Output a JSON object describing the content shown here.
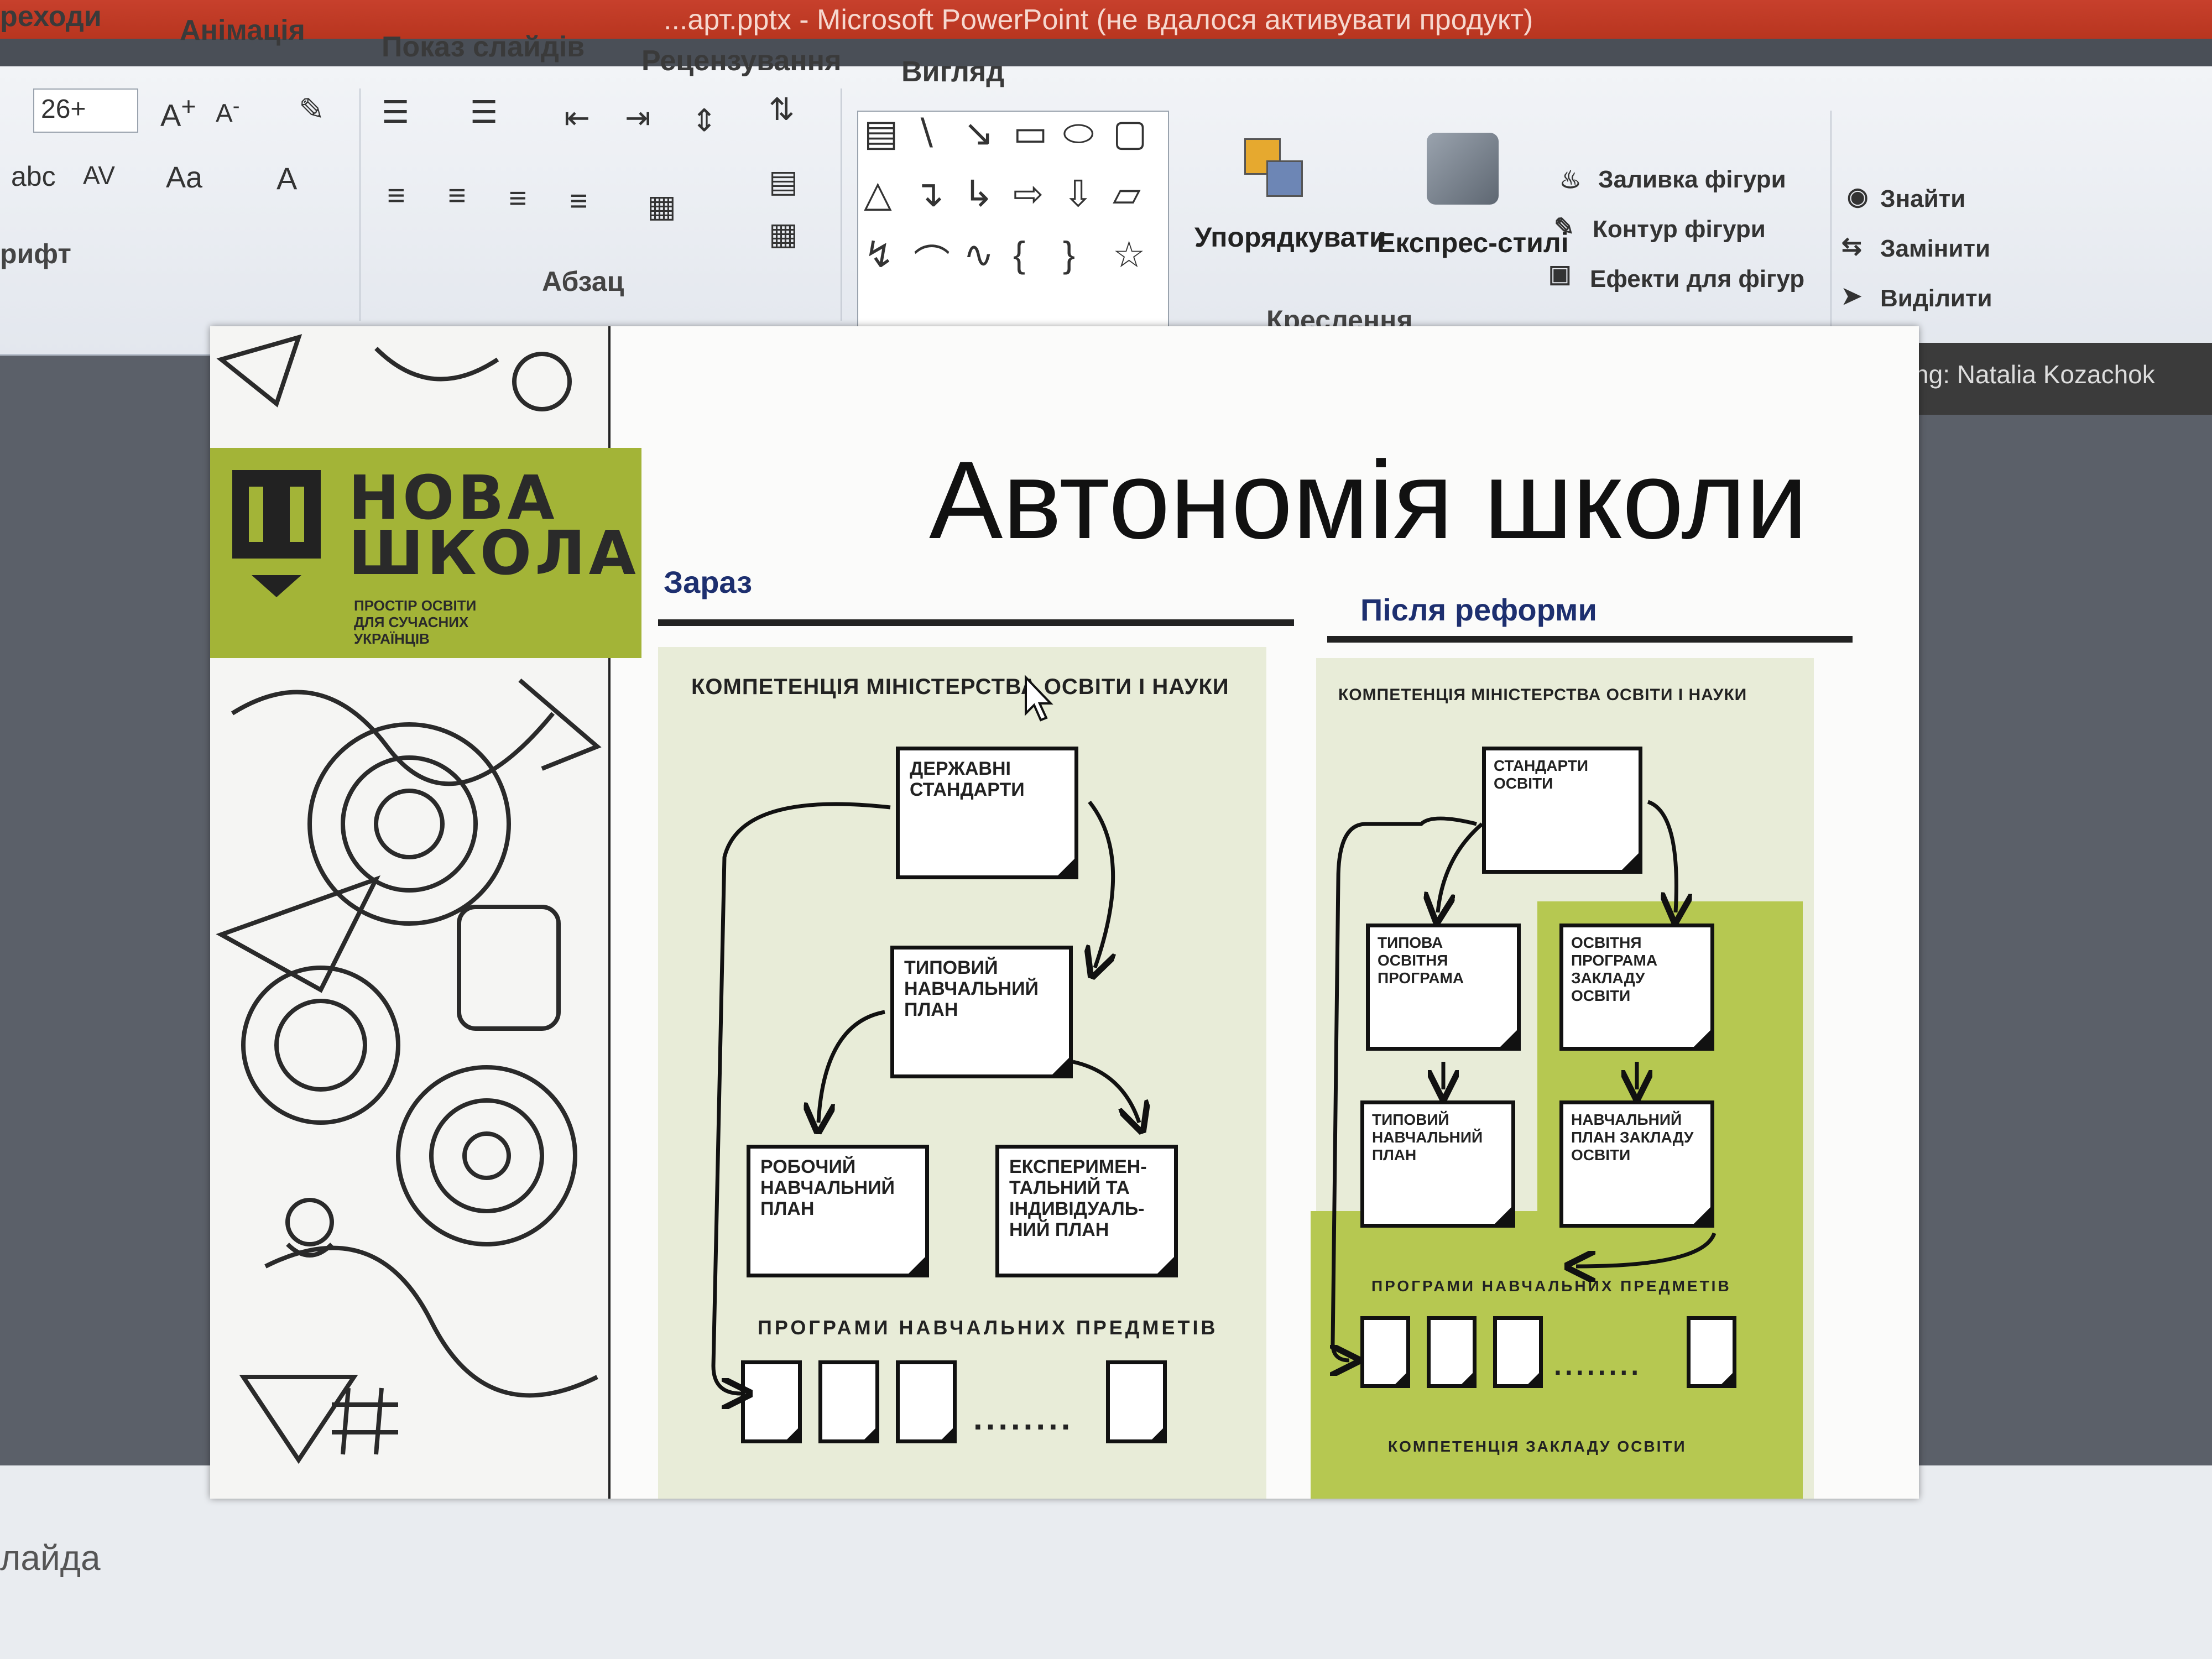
{
  "window": {
    "title": "...арт.pptx - Microsoft PowerPoint (не вдалося активувати продукт)"
  },
  "tabs": [
    "реходи",
    "Анімація",
    "Показ слайдів",
    "Рецензування",
    "Вигляд"
  ],
  "ribbon": {
    "font_size": "26+",
    "groups": {
      "font": "рифт",
      "paragraph": "Абзац",
      "drawing": "Креслення"
    },
    "arrange": "Упорядкувати",
    "quick_styles": "Експрес-стилі",
    "shape_fill": "Заливка фігури",
    "shape_outline": "Контур фігури",
    "shape_effects": "Ефекти для фігур",
    "find": "Знайти",
    "replace": "Замінити",
    "select": "Виділити"
  },
  "tooltip": "Talking: Natalia Kozachok",
  "notes_label": "лайда",
  "slide": {
    "logo": {
      "title_line1": "НОВА",
      "title_line2": "ШКОЛА",
      "subtitle": "ПРОСТІР ОСВІТИ ДЛЯ СУЧАСНИХ УКРАЇНЦІВ"
    },
    "title": "Автономія школи",
    "now_label": "Зараз",
    "after_label": "Після реформи",
    "left": {
      "heading": "КОМПЕТЕНЦІЯ МІНІСТЕРСТВА ОСВІТИ І НАУКИ",
      "state_standards": "ДЕРЖАВНІ СТАНДАРТИ",
      "typical_plan": "ТИПОВИЙ НАВЧАЛЬНИЙ ПЛАН",
      "working_plan": "РОБОЧИЙ НАВЧАЛЬНИЙ ПЛАН",
      "experimental_plan": "ЕКСПЕРИМЕН-ТАЛЬНИЙ ТА ІНДИВІДУАЛЬ-НИЙ ПЛАН",
      "programs": "ПРОГРАМИ НАВЧАЛЬНИХ ПРЕДМЕТІВ",
      "dots": "........"
    },
    "right": {
      "heading": "КОМПЕТЕНЦІЯ МІНІСТЕРСТВА ОСВІТИ І НАУКИ",
      "standards": "СТАНДАРТИ ОСВІТИ",
      "typical_program": "ТИПОВА ОСВІТНЯ ПРОГРАМА",
      "school_program": "ОСВІТНЯ ПРОГРАМА ЗАКЛАДУ ОСВІТИ",
      "typical_plan": "ТИПОВИЙ НАВЧАЛЬНИЙ ПЛАН",
      "school_plan": "НАВЧАЛЬНИЙ ПЛАН ЗАКЛАДУ ОСВІТИ",
      "programs": "ПРОГРАМИ НАВЧАЛЬНИХ ПРЕДМЕТІВ",
      "dots": "........",
      "school_competence": "КОМПЕТЕНЦІЯ ЗАКЛАДУ ОСВІТИ"
    }
  },
  "colors": {
    "brand_green": "#a3b437",
    "panel_green": "#b6c851",
    "title_bar": "#c7402c"
  }
}
